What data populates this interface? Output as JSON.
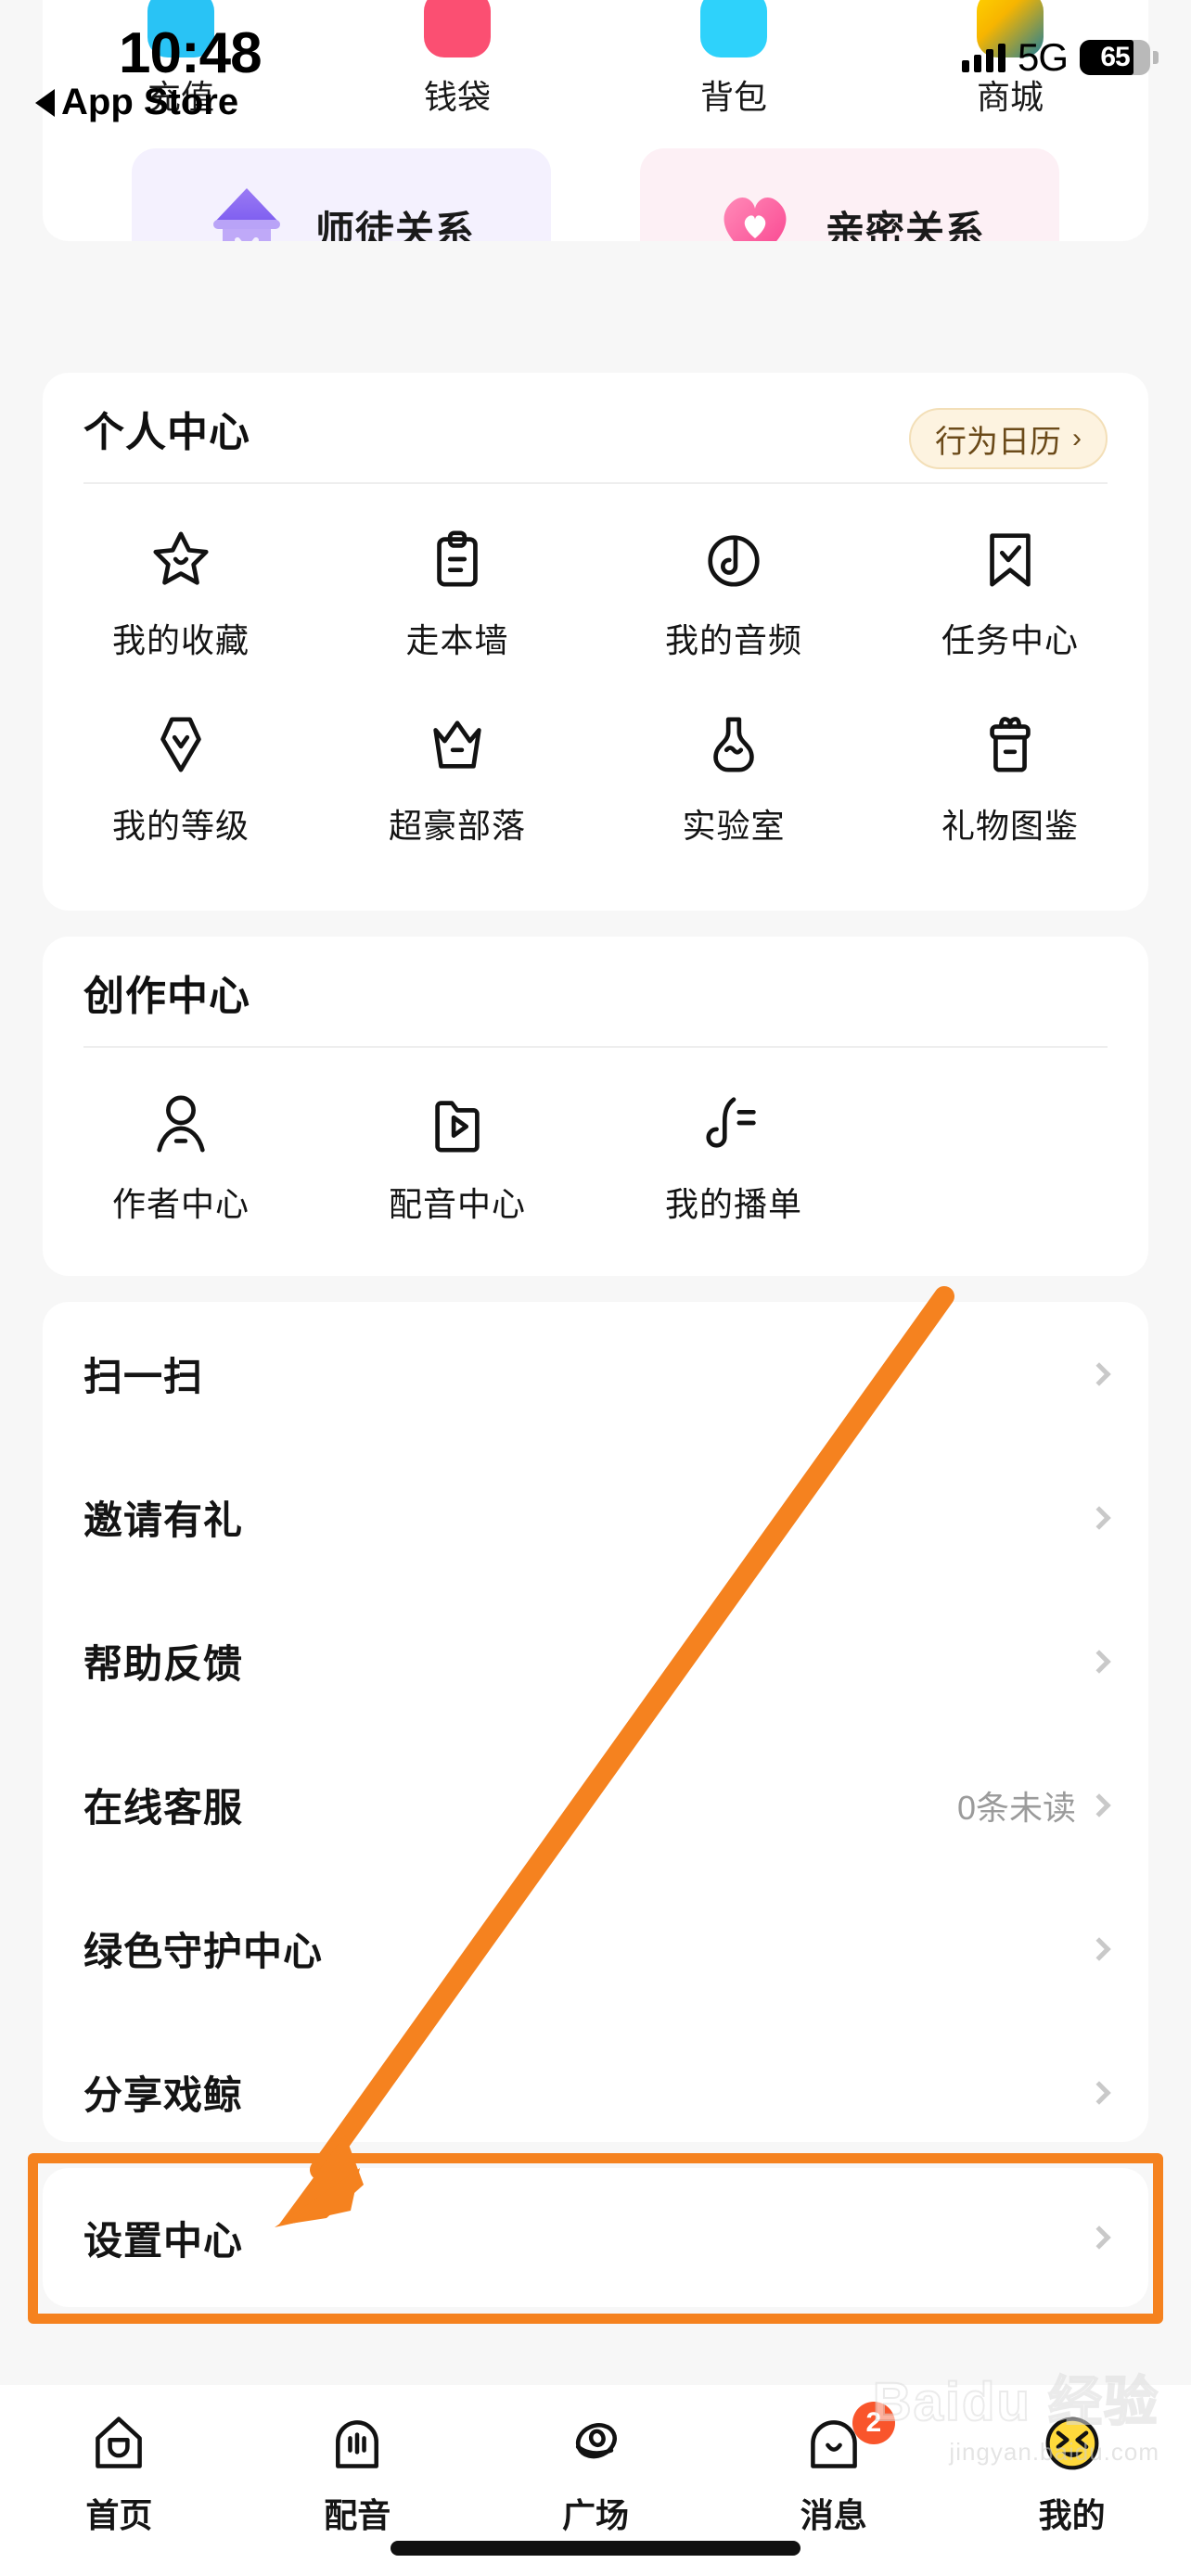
{
  "status_bar": {
    "time": "10:48",
    "back_label": "App Store",
    "network": "5G",
    "battery": "65"
  },
  "quick_row": {
    "items": [
      {
        "label": "充值",
        "icon": "recharge-icon",
        "color": "#29c3f5"
      },
      {
        "label": "钱袋",
        "icon": "wallet-icon",
        "color": "#fb4f72"
      },
      {
        "label": "背包",
        "icon": "backpack-icon",
        "color": "#2ed2fb"
      },
      {
        "label": "商城",
        "icon": "shop-icon",
        "color": "#f7b500"
      }
    ]
  },
  "relations": {
    "master": {
      "label": "师徒关系",
      "icon": "master-hat-icon",
      "bg": "#f4f1fe"
    },
    "intimate": {
      "label": "亲密关系",
      "icon": "heart-icon",
      "bg": "#fdf0f5"
    }
  },
  "personal_center": {
    "title": "个人中心",
    "calendar_badge": "行为日历",
    "chevron": "›",
    "items": [
      {
        "label": "我的收藏",
        "icon": "star-icon"
      },
      {
        "label": "走本墙",
        "icon": "clipboard-icon"
      },
      {
        "label": "我的音频",
        "icon": "audio-icon"
      },
      {
        "label": "任务中心",
        "icon": "bookmark-check-icon"
      },
      {
        "label": "我的等级",
        "icon": "level-badge-icon"
      },
      {
        "label": "超豪部落",
        "icon": "crown-icon"
      },
      {
        "label": "实验室",
        "icon": "flask-icon"
      },
      {
        "label": "礼物图鉴",
        "icon": "gift-icon"
      }
    ]
  },
  "creation_center": {
    "title": "创作中心",
    "items": [
      {
        "label": "作者中心",
        "icon": "person-icon"
      },
      {
        "label": "配音中心",
        "icon": "folder-play-icon"
      },
      {
        "label": "我的播单",
        "icon": "music-note-icon"
      }
    ]
  },
  "menu_list": {
    "items": [
      {
        "label": "扫一扫",
        "value": ""
      },
      {
        "label": "邀请有礼",
        "value": ""
      },
      {
        "label": "帮助反馈",
        "value": ""
      },
      {
        "label": "在线客服",
        "value": "0条未读"
      },
      {
        "label": "绿色守护中心",
        "value": ""
      },
      {
        "label": "分享戏鲸",
        "value": ""
      }
    ]
  },
  "settings_row": {
    "label": "设置中心",
    "value": ""
  },
  "annotation": {
    "highlight_color": "#f5821f",
    "target": "设置中心"
  },
  "tab_bar": {
    "items": [
      {
        "label": "首页",
        "icon": "home-icon",
        "badge": "",
        "active": false
      },
      {
        "label": "配音",
        "icon": "dubbing-icon",
        "badge": "",
        "active": false
      },
      {
        "label": "广场",
        "icon": "plaza-icon",
        "badge": "",
        "active": false
      },
      {
        "label": "消息",
        "icon": "message-icon",
        "badge": "2",
        "active": false
      },
      {
        "label": "我的",
        "icon": "profile-emoji-icon",
        "badge": "",
        "active": true
      }
    ]
  },
  "watermark": {
    "brand": "Baidu 经验",
    "url": "jingyan.baidu.com"
  }
}
